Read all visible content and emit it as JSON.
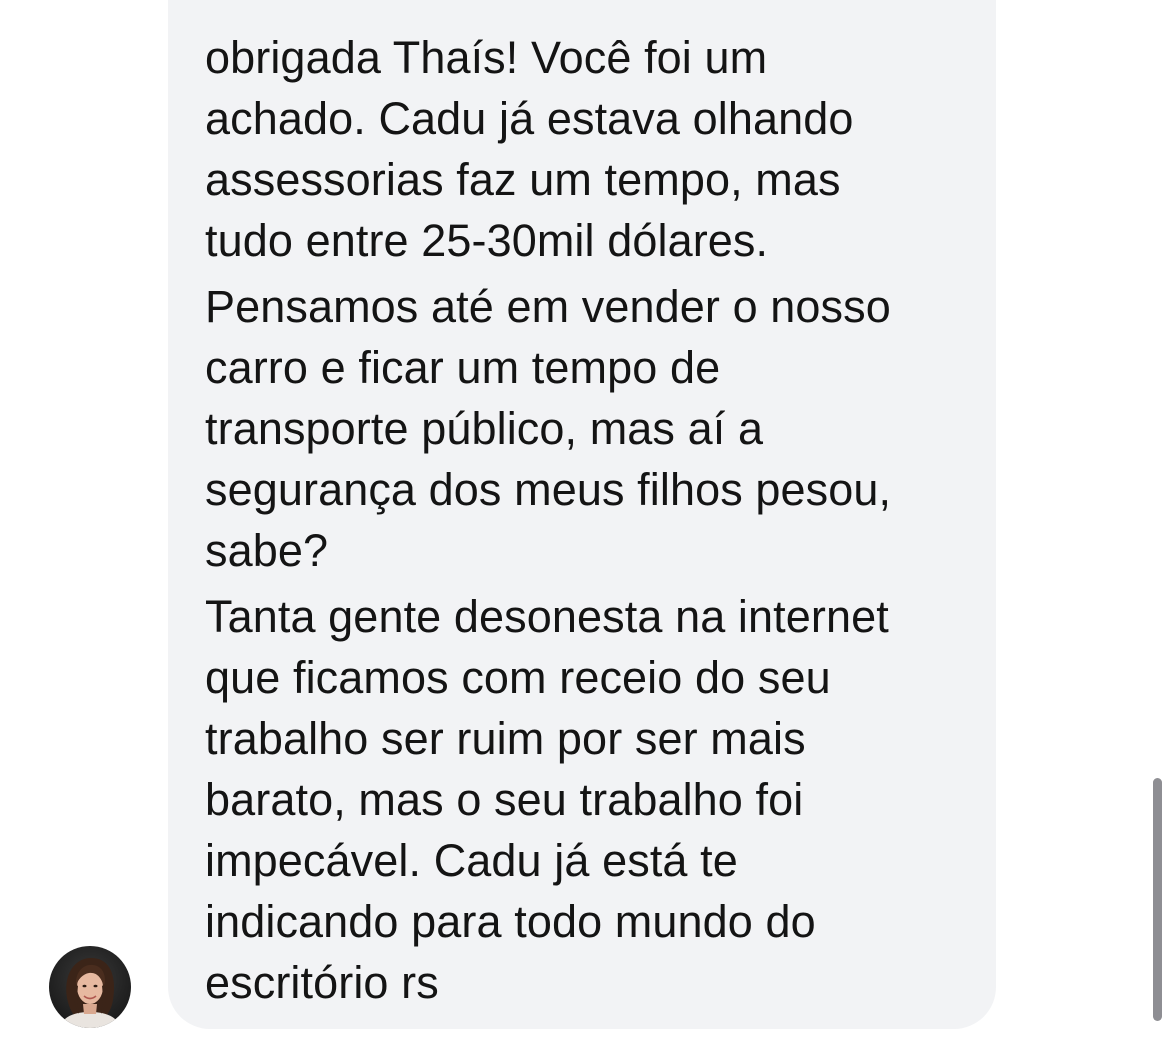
{
  "conversation": {
    "message": {
      "paragraphs": [
        {
          "lines": [
            "obrigada Thaís! Você foi um",
            "achado. Cadu já estava olhando",
            "assessorias faz um tempo, mas",
            "tudo entre 25-30mil dólares."
          ]
        },
        {
          "lines": [
            "Pensamos até em vender o nosso",
            "carro e ficar um tempo de",
            "transporte público, mas aí a",
            "segurança dos meus filhos pesou,",
            "sabe?"
          ]
        },
        {
          "lines": [
            "Tanta gente desonesta na internet",
            "que ficamos com receio do seu",
            "trabalho ser ruim por ser mais",
            "barato, mas o seu trabalho foi",
            "impecável. Cadu já está te",
            "indicando para todo mundo do",
            "escritório rs"
          ]
        }
      ]
    },
    "sender": {
      "avatar_icon": "person-photo-avatar"
    }
  },
  "colors": {
    "bubble_background": "#f2f3f5",
    "text": "#141414",
    "scrollbar": "#8e8e93",
    "page_background": "#ffffff"
  }
}
